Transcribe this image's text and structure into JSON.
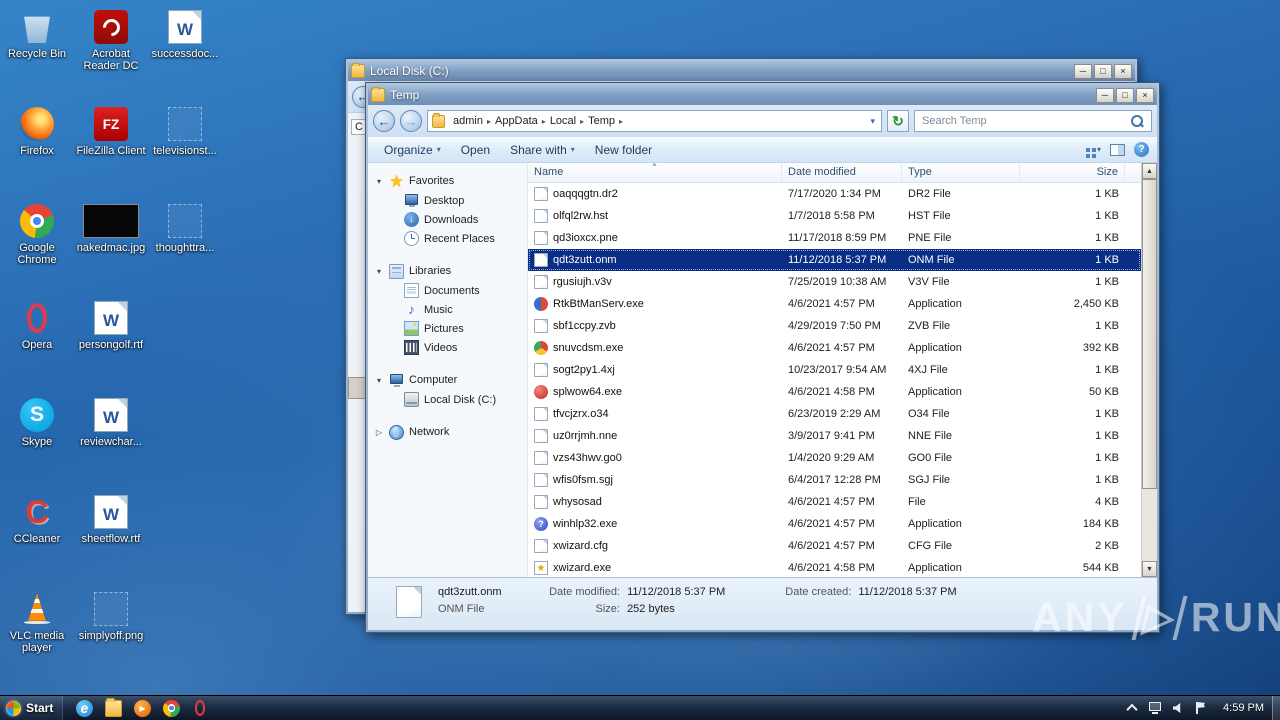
{
  "watermark": {
    "left": "ANY",
    "right": "RUN",
    "play": "▷"
  },
  "glyphs": {
    "minimize": "─",
    "maximize": "□",
    "close": "×",
    "back": "←",
    "forward": "→",
    "refresh": "↻",
    "dropdown": "▾",
    "crumb_sep": "▸",
    "help": "?",
    "sort": "▲",
    "scroll_up": "▲",
    "scroll_down": "▼",
    "expanded": "▾",
    "collapsed": "▷"
  },
  "desktop_icons": [
    {
      "label": "Recycle Bin",
      "icon": "recycle",
      "col": 0,
      "row": 0
    },
    {
      "label": "Acrobat Reader DC",
      "icon": "acrobat",
      "col": 1,
      "row": 0
    },
    {
      "label": "successdoc...",
      "icon": "word",
      "col": 2,
      "row": 0
    },
    {
      "label": "Firefox",
      "icon": "firefox",
      "col": 0,
      "row": 1
    },
    {
      "label": "FileZilla Client",
      "icon": "filezilla",
      "col": 1,
      "row": 1
    },
    {
      "label": "televisionst...",
      "icon": "ghost",
      "col": 2,
      "row": 1
    },
    {
      "label": "Google Chrome",
      "icon": "chrome",
      "col": 0,
      "row": 2
    },
    {
      "label": "nakedmac.jpg",
      "icon": "image-black",
      "col": 1,
      "row": 2
    },
    {
      "label": "thoughttra...",
      "icon": "ghost",
      "col": 2,
      "row": 2
    },
    {
      "label": "Opera",
      "icon": "opera",
      "col": 0,
      "row": 3
    },
    {
      "label": "persongolf.rtf",
      "icon": "word",
      "col": 1,
      "row": 3
    },
    {
      "label": "Skype",
      "icon": "skype",
      "col": 0,
      "row": 4
    },
    {
      "label": "reviewchar...",
      "icon": "word",
      "col": 1,
      "row": 4
    },
    {
      "label": "CCleaner",
      "icon": "ccleaner",
      "col": 0,
      "row": 5
    },
    {
      "label": "sheetflow.rtf",
      "icon": "word",
      "col": 1,
      "row": 5
    },
    {
      "label": "VLC media player",
      "icon": "vlc",
      "col": 0,
      "row": 6
    },
    {
      "label": "simplyoff.png",
      "icon": "ghost",
      "col": 1,
      "row": 6
    }
  ],
  "back_window": {
    "title": "Local Disk (C:)",
    "clipped_text": "C"
  },
  "explorer": {
    "title": "Temp",
    "breadcrumb": [
      "admin",
      "AppData",
      "Local",
      "Temp"
    ],
    "search_placeholder": "Search Temp",
    "toolbar": [
      {
        "label": "Organize",
        "caret": true
      },
      {
        "label": "Open",
        "caret": false
      },
      {
        "label": "Share with",
        "caret": true
      },
      {
        "label": "New folder",
        "caret": false
      }
    ],
    "sidebar": [
      {
        "label": "Favorites",
        "icon": "star",
        "expanded": true,
        "children": [
          {
            "label": "Desktop",
            "icon": "monitor"
          },
          {
            "label": "Downloads",
            "icon": "downloads"
          },
          {
            "label": "Recent Places",
            "icon": "recent"
          }
        ]
      },
      {
        "label": "Libraries",
        "icon": "libraries",
        "expanded": true,
        "children": [
          {
            "label": "Documents",
            "icon": "documents"
          },
          {
            "label": "Music",
            "icon": "music"
          },
          {
            "label": "Pictures",
            "icon": "pictures"
          },
          {
            "label": "Videos",
            "icon": "videos"
          }
        ]
      },
      {
        "label": "Computer",
        "icon": "monitor",
        "expanded": true,
        "children": [
          {
            "label": "Local Disk (C:)",
            "icon": "disk"
          }
        ]
      },
      {
        "label": "Network",
        "icon": "network",
        "expanded": false,
        "children": []
      }
    ],
    "columns": [
      {
        "label": "Name",
        "sorted": true
      },
      {
        "label": "Date modified",
        "sorted": false
      },
      {
        "label": "Type",
        "sorted": false
      },
      {
        "label": "Size",
        "sorted": false
      }
    ],
    "files": [
      {
        "name": "oaqqqgtn.dr2",
        "date": "7/17/2020 1:34 PM",
        "type": "DR2 File",
        "size": "1 KB",
        "icon": "page",
        "selected": false
      },
      {
        "name": "olfql2rw.hst",
        "date": "1/7/2018 5:58 PM",
        "type": "HST File",
        "size": "1 KB",
        "icon": "page",
        "selected": false
      },
      {
        "name": "qd3ioxcx.pne",
        "date": "11/17/2018 8:59 PM",
        "type": "PNE File",
        "size": "1 KB",
        "icon": "page",
        "selected": false
      },
      {
        "name": "qdt3zutt.onm",
        "date": "11/12/2018 5:37 PM",
        "type": "ONM File",
        "size": "1 KB",
        "icon": "page",
        "selected": true
      },
      {
        "name": "rgusiujh.v3v",
        "date": "7/25/2019 10:38 AM",
        "type": "V3V File",
        "size": "1 KB",
        "icon": "page",
        "selected": false
      },
      {
        "name": "RtkBtManServ.exe",
        "date": "4/6/2021 4:57 PM",
        "type": "Application",
        "size": "2,450 KB",
        "icon": "exe-app",
        "selected": false
      },
      {
        "name": "sbf1ccpy.zvb",
        "date": "4/29/2019 7:50 PM",
        "type": "ZVB File",
        "size": "1 KB",
        "icon": "page",
        "selected": false
      },
      {
        "name": "snuvcdsm.exe",
        "date": "4/6/2021 4:57 PM",
        "type": "Application",
        "size": "392 KB",
        "icon": "exe-color",
        "selected": false
      },
      {
        "name": "sogt2py1.4xj",
        "date": "10/23/2017 9:54 AM",
        "type": "4XJ File",
        "size": "1 KB",
        "icon": "page",
        "selected": false
      },
      {
        "name": "splwow64.exe",
        "date": "4/6/2021 4:58 PM",
        "type": "Application",
        "size": "50 KB",
        "icon": "exe-red",
        "selected": false
      },
      {
        "name": "tfvcjzrx.o34",
        "date": "6/23/2019 2:29 AM",
        "type": "O34 File",
        "size": "1 KB",
        "icon": "page",
        "selected": false
      },
      {
        "name": "uz0rrjmh.nne",
        "date": "3/9/2017 9:41 PM",
        "type": "NNE File",
        "size": "1 KB",
        "icon": "page",
        "selected": false
      },
      {
        "name": "vzs43hwv.go0",
        "date": "1/4/2020 9:29 AM",
        "type": "GO0 File",
        "size": "1 KB",
        "icon": "page",
        "selected": false
      },
      {
        "name": "wfis0fsm.sgj",
        "date": "6/4/2017 12:28 PM",
        "type": "SGJ File",
        "size": "1 KB",
        "icon": "page",
        "selected": false
      },
      {
        "name": "whysosad",
        "date": "4/6/2021 4:57 PM",
        "type": "File",
        "size": "4 KB",
        "icon": "page",
        "selected": false
      },
      {
        "name": "winhlp32.exe",
        "date": "4/6/2021 4:57 PM",
        "type": "Application",
        "size": "184 KB",
        "icon": "exe-help",
        "selected": false
      },
      {
        "name": "xwizard.cfg",
        "date": "4/6/2021 4:57 PM",
        "type": "CFG File",
        "size": "2 KB",
        "icon": "page",
        "selected": false
      },
      {
        "name": "xwizard.exe",
        "date": "4/6/2021 4:58 PM",
        "type": "Application",
        "size": "544 KB",
        "icon": "exe-wizard",
        "selected": false
      }
    ],
    "details": {
      "name": "qdt3zutt.onm",
      "type": "ONM File",
      "date_modified_label": "Date modified:",
      "date_modified": "11/12/2018 5:37 PM",
      "size_label": "Size:",
      "size": "252 bytes",
      "date_created_label": "Date created:",
      "date_created": "11/12/2018 5:37 PM"
    }
  },
  "taskbar": {
    "start_label": "Start",
    "quick_launch": [
      {
        "name": "internet-explorer",
        "icon": "ie"
      },
      {
        "name": "windows-explorer",
        "icon": "folder"
      },
      {
        "name": "media-player",
        "icon": "media"
      },
      {
        "name": "google-chrome",
        "icon": "chrome"
      },
      {
        "name": "opera",
        "icon": "opera"
      }
    ],
    "tray_icons": [
      "chevron-up",
      "network",
      "volume",
      "flag"
    ],
    "clock": "4:59 PM"
  }
}
